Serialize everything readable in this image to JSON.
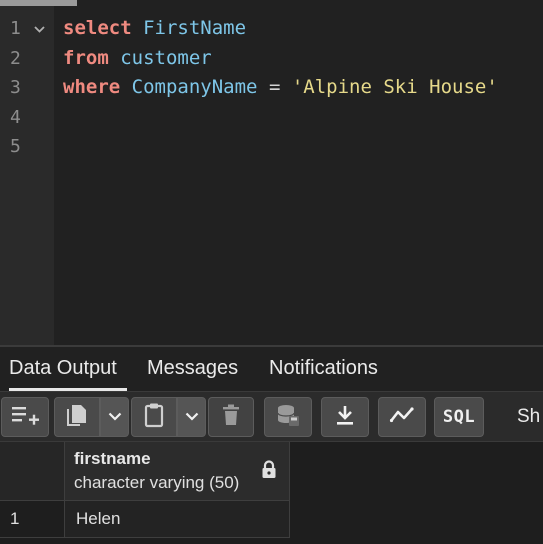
{
  "editor": {
    "lines": [
      {
        "number": "1",
        "tokens": {
          "kw": "select",
          "id": "FirstName"
        }
      },
      {
        "number": "2",
        "tokens": {
          "kw": "from",
          "id": "customer"
        }
      },
      {
        "number": "3",
        "tokens": {
          "kw": "where",
          "id": "CompanyName",
          "op": "=",
          "str": "'Alpine Ski House'"
        }
      },
      {
        "number": "4"
      },
      {
        "number": "5"
      }
    ]
  },
  "tabs": [
    {
      "label": "Data Output",
      "active": true
    },
    {
      "label": "Messages"
    },
    {
      "label": "Notifications"
    }
  ],
  "toolbar": {
    "buttons": [
      "add-row-icon",
      "copy-icon",
      "chevron-down-icon",
      "paste-icon",
      "chevron-down-icon",
      "delete-icon",
      "save-data-icon",
      "download-icon",
      "graph-icon",
      "sql-icon"
    ],
    "sql_label": "SQL",
    "show_label": "Sh"
  },
  "grid": {
    "columns": [
      {
        "name": "firstname",
        "type": "character varying (50)",
        "icon": "lock-icon"
      }
    ],
    "rows": [
      {
        "index": "1",
        "cells": [
          "Helen"
        ]
      }
    ]
  },
  "colors": {
    "keyword": "#ef8a80",
    "identifier": "#7ec6e8",
    "string": "#e6d98a",
    "background": "#212121"
  }
}
